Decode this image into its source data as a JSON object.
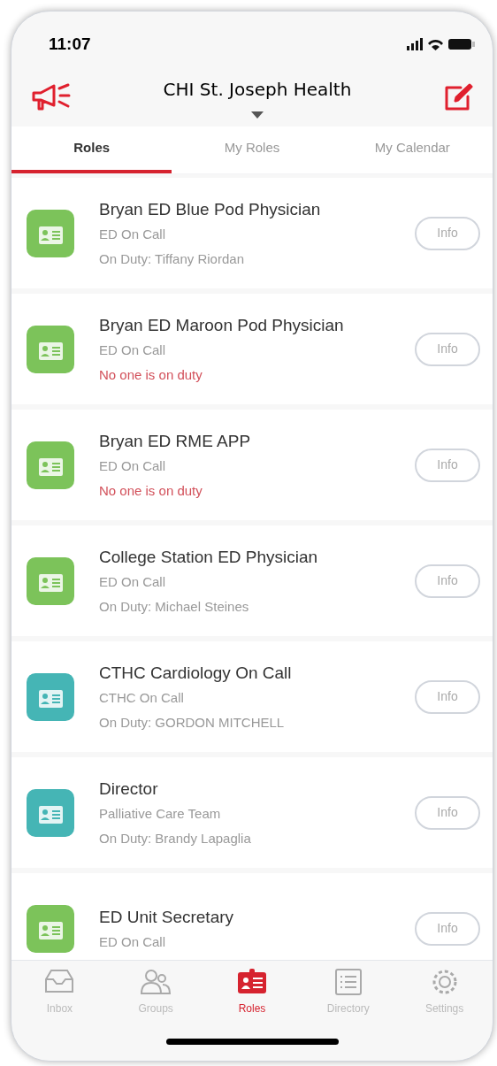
{
  "status_bar": {
    "time": "11:07"
  },
  "header": {
    "title": "CHI St. Joseph Health"
  },
  "tabs": [
    {
      "label": "Roles",
      "selected": true
    },
    {
      "label": "My Roles",
      "selected": false
    },
    {
      "label": "My Calendar",
      "selected": false
    }
  ],
  "roles": [
    {
      "title": "Bryan ED Blue Pod Physician",
      "group": "ED On Call",
      "duty": "On Duty: Tiffany Riordan",
      "staffed": true,
      "color": "#7cc35a",
      "button": "Info"
    },
    {
      "title": "Bryan ED Maroon Pod Physician",
      "group": "ED On Call",
      "duty": "No one is on duty",
      "staffed": false,
      "color": "#7cc35a",
      "button": "Info"
    },
    {
      "title": "Bryan ED RME APP",
      "group": "ED On Call",
      "duty": "No one is on duty",
      "staffed": false,
      "color": "#7cc35a",
      "button": "Info"
    },
    {
      "title": "College Station ED Physician",
      "group": "ED On Call",
      "duty": "On Duty: Michael Steines",
      "staffed": true,
      "color": "#7cc35a",
      "button": "Info"
    },
    {
      "title": "CTHC Cardiology On Call",
      "group": "CTHC On Call",
      "duty": "On Duty: GORDON MITCHELL",
      "staffed": true,
      "color": "#45b5b5",
      "button": "Info"
    },
    {
      "title": "Director",
      "group": "Palliative Care Team",
      "duty": "On Duty: Brandy Lapaglia",
      "staffed": true,
      "color": "#45b5b5",
      "button": "Info"
    },
    {
      "title": "ED Unit Secretary",
      "group": "ED On Call",
      "color": "#7cc35a",
      "button": "Info"
    }
  ],
  "bottom_nav": [
    {
      "label": "Inbox",
      "selected": false
    },
    {
      "label": "Groups",
      "selected": false
    },
    {
      "label": "Roles",
      "selected": true
    },
    {
      "label": "Directory",
      "selected": false
    },
    {
      "label": "Settings",
      "selected": false
    }
  ]
}
